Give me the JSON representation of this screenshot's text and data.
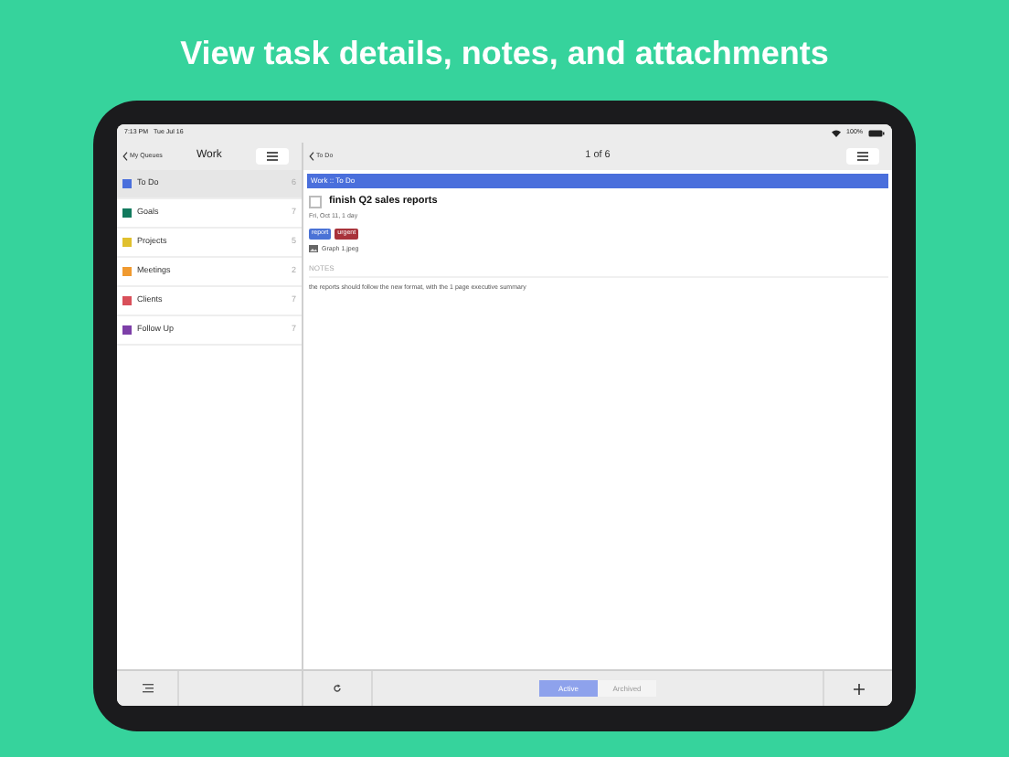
{
  "headline": "View task details, notes, and attachments",
  "status_bar": {
    "time": "7:13 PM",
    "date": "Tue Jul 16",
    "battery": "100%"
  },
  "sidebar": {
    "back": "My Queues",
    "title": "Work",
    "items": [
      {
        "label": "To Do",
        "count": "6",
        "color": "#4a6fdc",
        "selected": true
      },
      {
        "label": "Goals",
        "count": "7",
        "color": "#127a5e",
        "selected": false
      },
      {
        "label": "Projects",
        "count": "5",
        "color": "#e0c02e",
        "selected": false
      },
      {
        "label": "Meetings",
        "count": "2",
        "color": "#f09a30",
        "selected": false
      },
      {
        "label": "Clients",
        "count": "7",
        "color": "#d9505a",
        "selected": false
      },
      {
        "label": "Follow Up",
        "count": "7",
        "color": "#7d3fa8",
        "selected": false
      }
    ]
  },
  "detail": {
    "back": "To Do",
    "position": "1 of 6",
    "breadcrumb": "Work :: To Do",
    "task": {
      "title": "finish Q2 sales reports",
      "checked": false,
      "due": "Fri, Oct 11, 1 day",
      "tags": [
        {
          "label": "report",
          "color": "#4a72d6"
        },
        {
          "label": "urgent",
          "color": "#a8323a"
        }
      ],
      "attachment": "Graph 1.jpeg"
    },
    "notes_label": "NOTES",
    "notes": "the reports should follow the new format, with the 1 page executive summary"
  },
  "segments": [
    {
      "label": "Active",
      "selected": true
    },
    {
      "label": "Archived",
      "selected": false
    }
  ]
}
